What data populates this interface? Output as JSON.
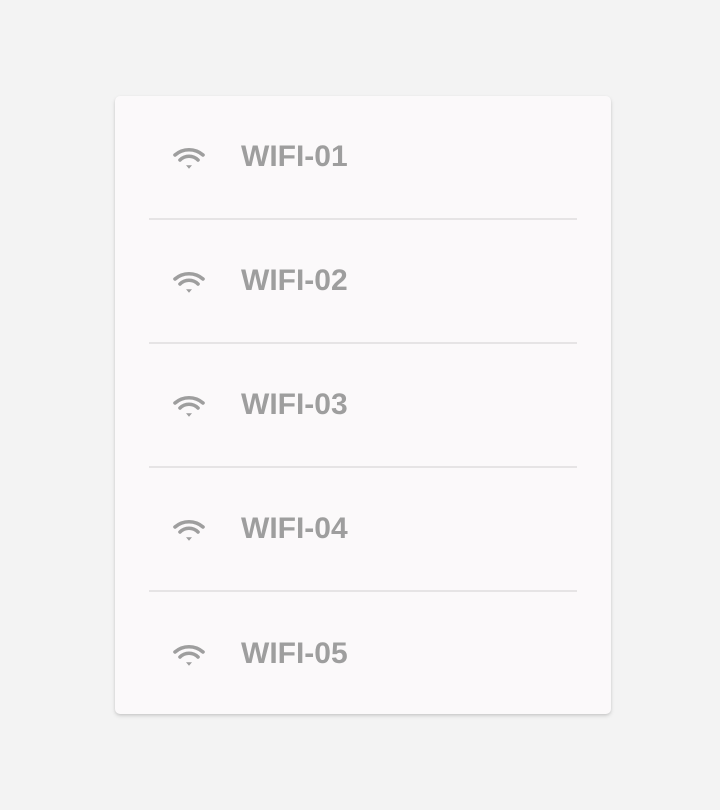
{
  "wifi_list": {
    "items": [
      {
        "label": "WIFI-01",
        "icon": "wifi-icon"
      },
      {
        "label": "WIFI-02",
        "icon": "wifi-icon"
      },
      {
        "label": "WIFI-03",
        "icon": "wifi-icon"
      },
      {
        "label": "WIFI-04",
        "icon": "wifi-icon"
      },
      {
        "label": "WIFI-05",
        "icon": "wifi-icon"
      }
    ]
  },
  "colors": {
    "background": "#f3f3f3",
    "card": "#fbf9fa",
    "divider": "#e6e4e5",
    "text": "#9e9e9e",
    "icon": "#9e9e9e"
  }
}
